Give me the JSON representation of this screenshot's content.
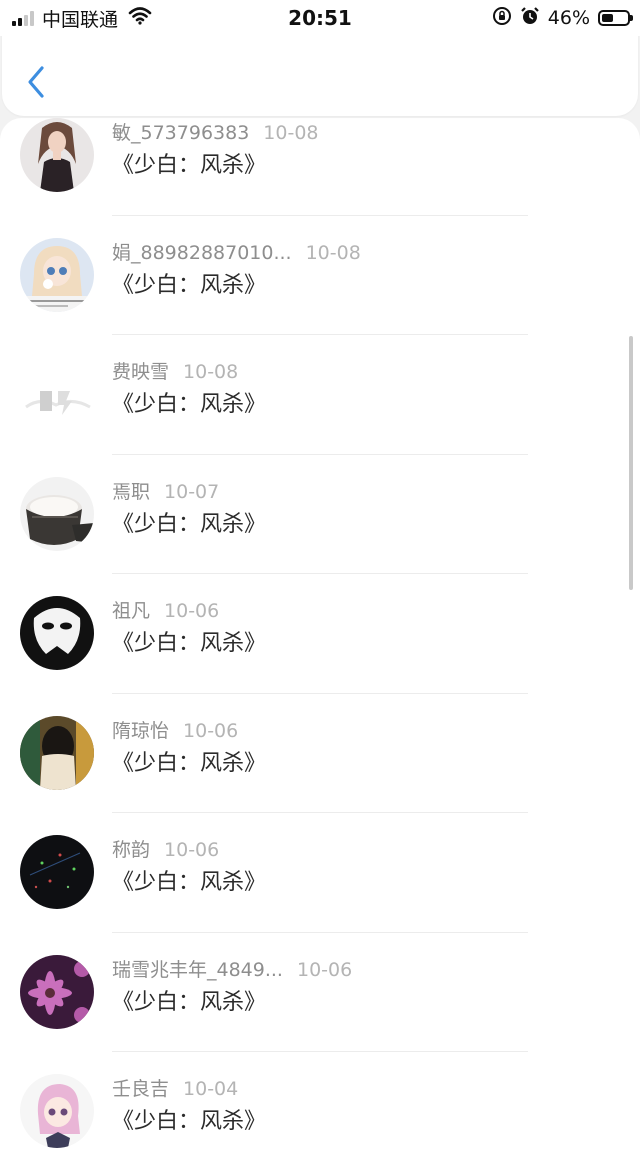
{
  "status_bar": {
    "carrier": "中国联通",
    "time": "20:51",
    "battery_percent": "46%",
    "battery_level": 0.46,
    "signal_bars": 2
  },
  "nav": {
    "back_icon": "chevron-left-icon"
  },
  "colors": {
    "accent": "#3d8ee0",
    "name": "#8e8e8e",
    "date": "#b4b4b4",
    "title": "#2b2b2b"
  },
  "items": [
    {
      "name": "敏_573796383",
      "date": "10-08",
      "title": "《少白：风杀》",
      "avatar": "woman-black-dress"
    },
    {
      "name": "娟_88982887010...",
      "date": "10-08",
      "title": "《少白：风杀》",
      "avatar": "anime-doll"
    },
    {
      "name": "费映雪",
      "date": "10-08",
      "title": "《少白：风杀》",
      "avatar": "light-logo"
    },
    {
      "name": "焉职",
      "date": "10-07",
      "title": "《少白：风杀》",
      "avatar": "rice-bucket"
    },
    {
      "name": "祖凡",
      "date": "10-06",
      "title": "《少白：风杀》",
      "avatar": "white-mask"
    },
    {
      "name": "隋琼怡",
      "date": "10-06",
      "title": "《少白：风杀》",
      "avatar": "girl-back"
    },
    {
      "name": "称韵",
      "date": "10-06",
      "title": "《少白：风杀》",
      "avatar": "night-lights"
    },
    {
      "name": "瑞雪兆丰年_4849...",
      "date": "10-06",
      "title": "《少白：风杀》",
      "avatar": "purple-flowers"
    },
    {
      "name": "壬良吉",
      "date": "10-04",
      "title": "《少白：风杀》",
      "avatar": "anime-pink-hair"
    }
  ]
}
